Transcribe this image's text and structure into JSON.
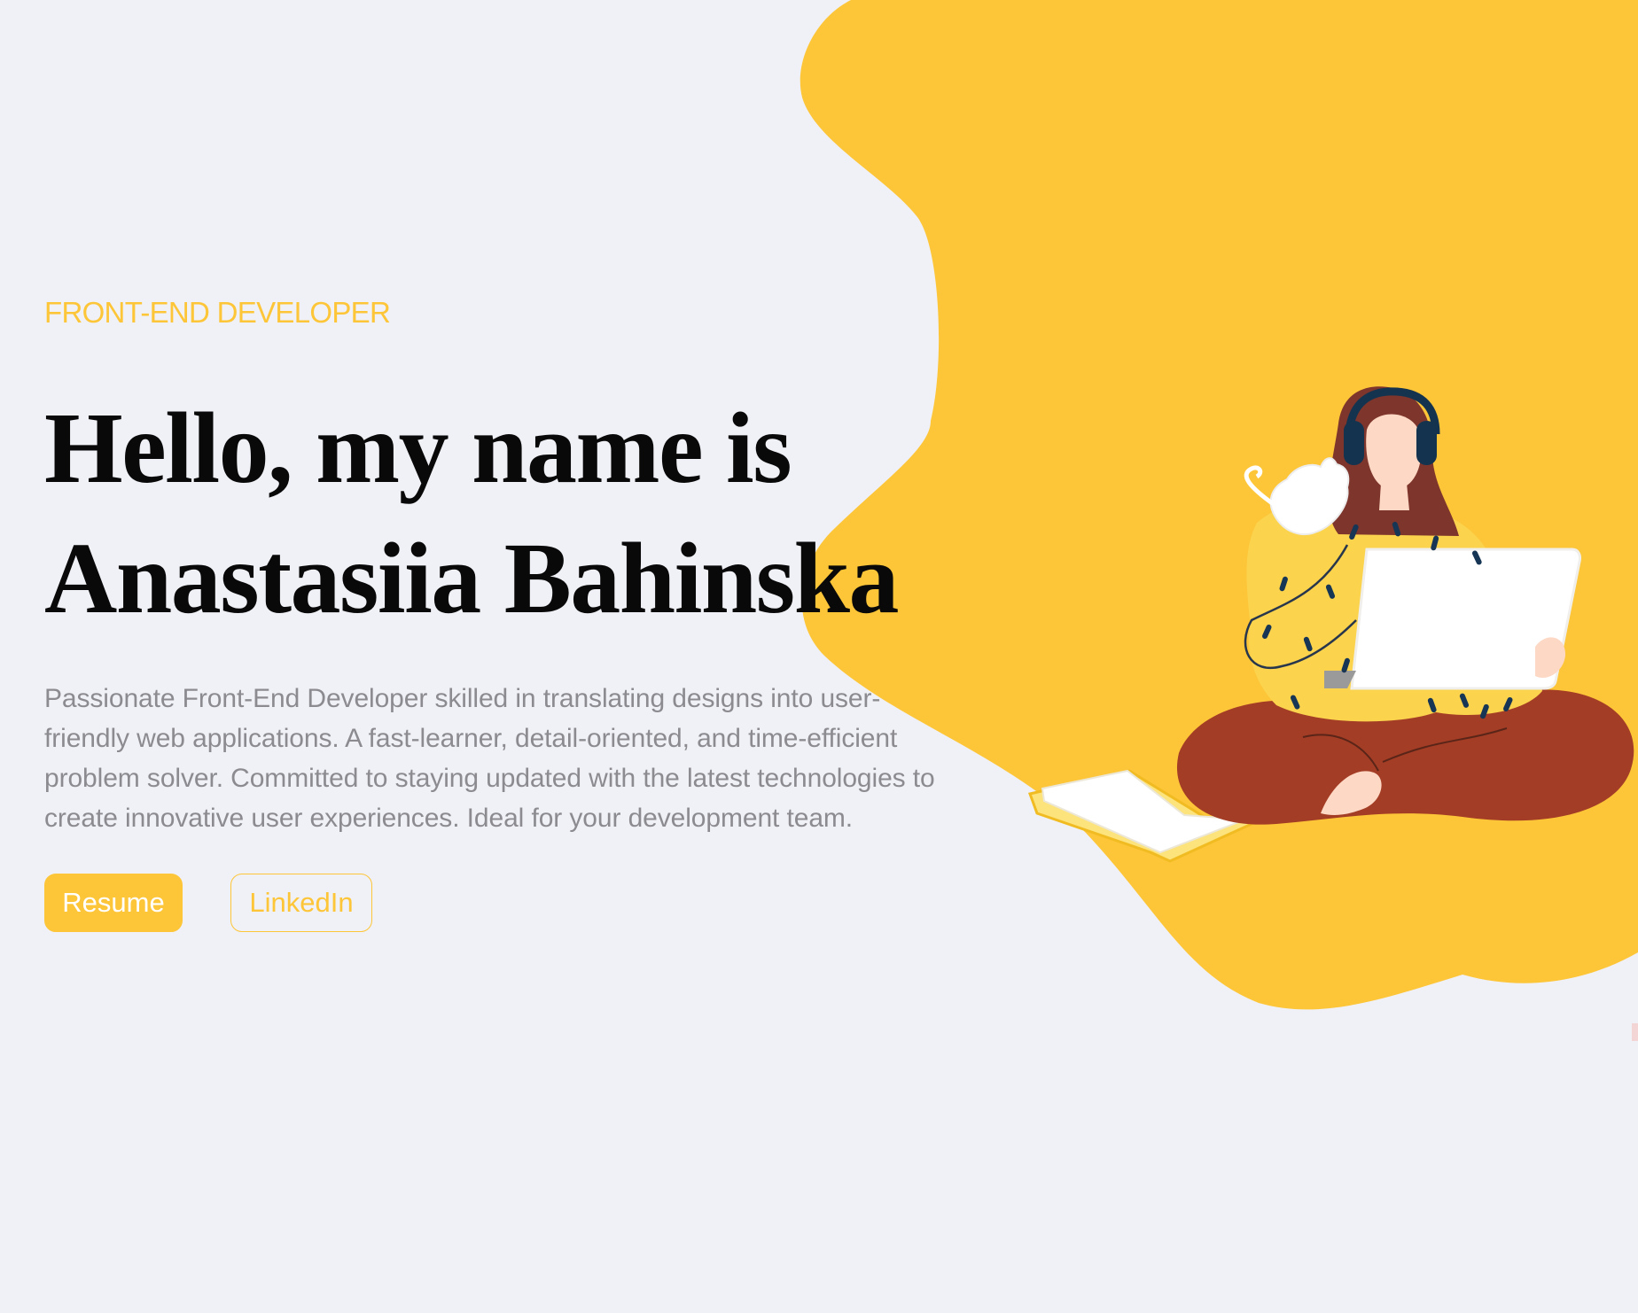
{
  "hero": {
    "subtitle": "FRONT-END DEVELOPER",
    "title_line_1": "Hello, my name is",
    "title_line_2": "Anastasiia Bahinska",
    "description": "Passionate Front-End Developer skilled in translating designs into user-friendly web applications. A fast-learner, detail-oriented, and time-efficient problem solver. Committed to staying updated with the latest technologies to create innovative user experiences. Ideal for your development team."
  },
  "actions": {
    "resume_label": "Resume",
    "linkedin_label": "LinkedIn"
  },
  "illustration": {
    "subject": "woman-with-laptop-headphones-cat-book",
    "icon_name": "developer-illustration"
  },
  "theme": {
    "background": "#f0f1f6",
    "accent": "#fdc538",
    "title": "#090909",
    "body_text": "#8b8b90",
    "sweater": "#fbd34d",
    "trousers": "#a33d25",
    "hair": "#7e352c",
    "skin": "#fdd8c4"
  }
}
